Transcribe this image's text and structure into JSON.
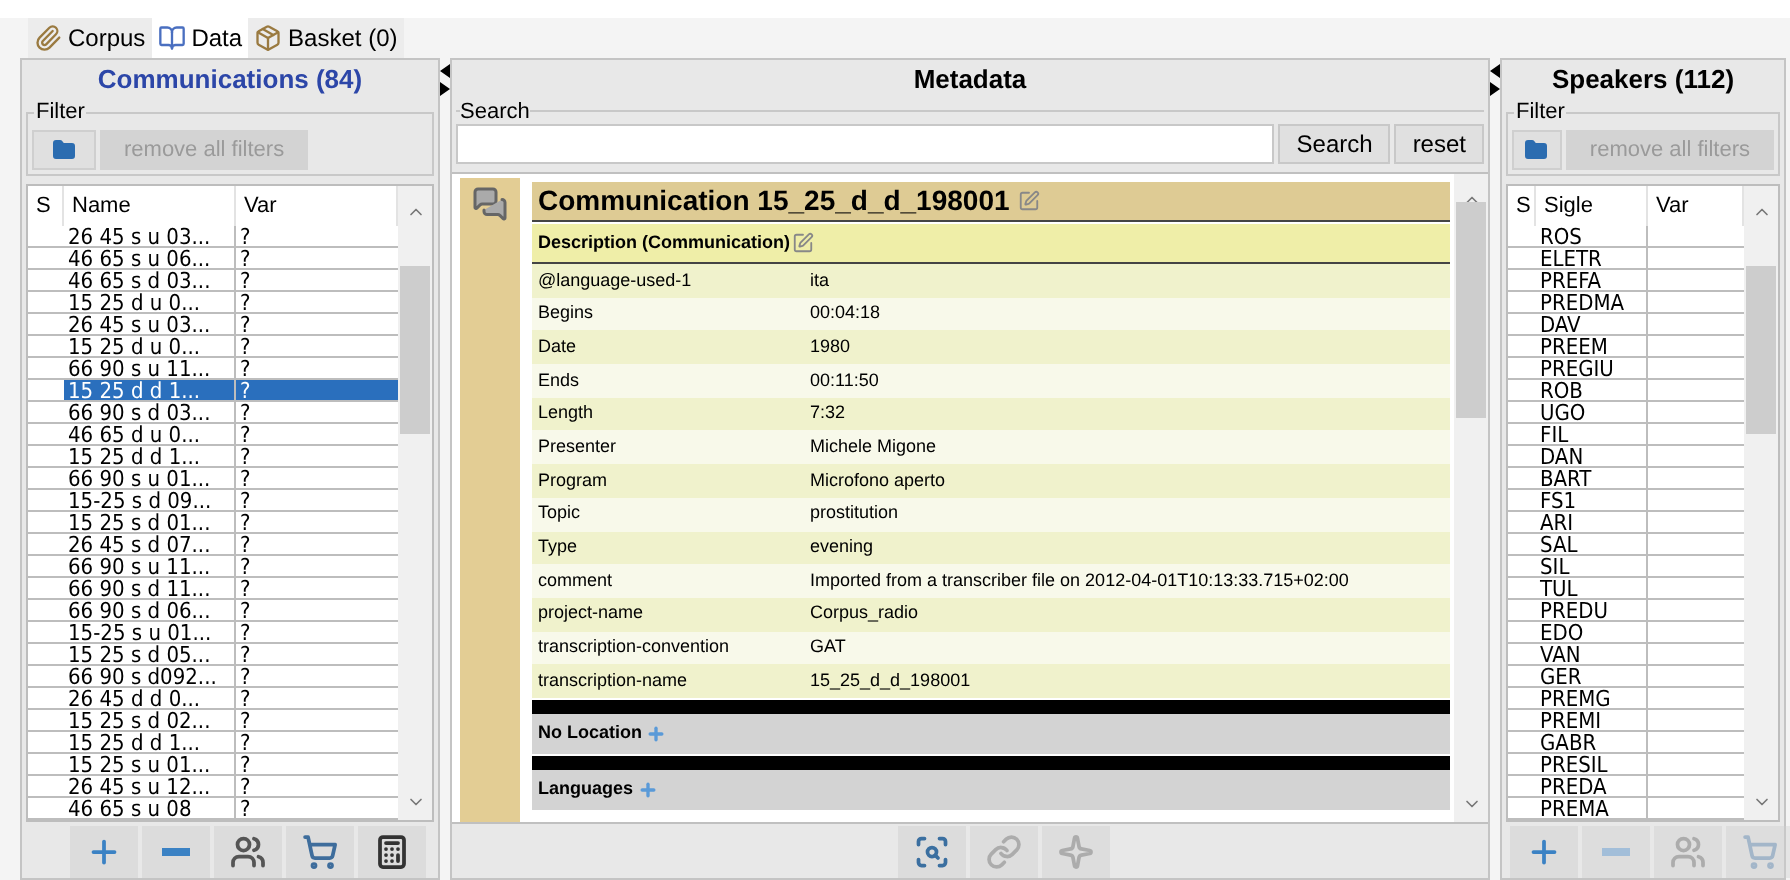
{
  "tabs": [
    {
      "label": "Corpus",
      "selected": false
    },
    {
      "label": "Data",
      "selected": true
    },
    {
      "label": "Basket (0)",
      "selected": false
    }
  ],
  "communications": {
    "title": "Communications (84)",
    "filter_label": "Filter",
    "remove_filters": {
      "label": "remove all filters",
      "disabled": true
    },
    "columns": [
      "S",
      "Name",
      "Var"
    ],
    "rows": [
      {
        "name": "26 45 s u 03...",
        "var": "?",
        "selected": false
      },
      {
        "name": "46 65 s u 06...",
        "var": "?",
        "selected": false
      },
      {
        "name": "46 65 s d 03...",
        "var": "?",
        "selected": false
      },
      {
        "name": "15 25 d u 0...",
        "var": "?",
        "selected": false
      },
      {
        "name": "26 45 s u 03...",
        "var": "?",
        "selected": false
      },
      {
        "name": "15 25 d u 0...",
        "var": "?",
        "selected": false
      },
      {
        "name": "66 90 s u 11...",
        "var": "?",
        "selected": false
      },
      {
        "name": "15 25 d d 1...",
        "var": "?",
        "selected": true
      },
      {
        "name": "66 90 s d 03...",
        "var": "?",
        "selected": false
      },
      {
        "name": "46 65 d u 0...",
        "var": "?",
        "selected": false
      },
      {
        "name": "15 25 d d 1...",
        "var": "?",
        "selected": false
      },
      {
        "name": "66 90 s u 01...",
        "var": "?",
        "selected": false
      },
      {
        "name": "15-25 s d 09...",
        "var": "?",
        "selected": false
      },
      {
        "name": "15 25 s d 01...",
        "var": "?",
        "selected": false
      },
      {
        "name": "26 45 s d 07...",
        "var": "?",
        "selected": false
      },
      {
        "name": "66 90 s u 11...",
        "var": "?",
        "selected": false
      },
      {
        "name": "66 90 s d 11...",
        "var": "?",
        "selected": false
      },
      {
        "name": "66 90 s d 06...",
        "var": "?",
        "selected": false
      },
      {
        "name": "15-25 s u 01...",
        "var": "?",
        "selected": false
      },
      {
        "name": "15 25 s d 05...",
        "var": "?",
        "selected": false
      },
      {
        "name": "66 90 s d092...",
        "var": "?",
        "selected": false
      },
      {
        "name": "26 45 d d 0...",
        "var": "?",
        "selected": false
      },
      {
        "name": "15 25 s d 02...",
        "var": "?",
        "selected": false
      },
      {
        "name": "15 25 d d 1...",
        "var": "?",
        "selected": false
      },
      {
        "name": "15 25 s u 01...",
        "var": "?",
        "selected": false
      },
      {
        "name": "26 45 s u 12...",
        "var": "?",
        "selected": false
      },
      {
        "name": "46 65 s u 08",
        "var": "?",
        "selected": false
      }
    ],
    "toolbar": [
      {
        "kind": "add",
        "disabled": false
      },
      {
        "kind": "remove",
        "disabled": false
      },
      {
        "kind": "people",
        "disabled": false
      },
      {
        "kind": "basket",
        "disabled": false
      },
      {
        "kind": "calculator",
        "disabled": false
      }
    ]
  },
  "metadata": {
    "title": "Metadata",
    "search_label": "Search",
    "search_button": "Search",
    "reset_button": "reset",
    "communication_title": "Communication 15_25_d_d_198001",
    "description_heading": "Description (Communication)",
    "fields": [
      {
        "key": "@language-used-1",
        "value": "ita"
      },
      {
        "key": "Begins",
        "value": "00:04:18"
      },
      {
        "key": "Date",
        "value": "1980"
      },
      {
        "key": "Ends",
        "value": "00:11:50"
      },
      {
        "key": "Length",
        "value": "7:32"
      },
      {
        "key": "Presenter",
        "value": "Michele Migone"
      },
      {
        "key": "Program",
        "value": "Microfono aperto"
      },
      {
        "key": "Topic",
        "value": "prostitution"
      },
      {
        "key": "Type",
        "value": "evening"
      },
      {
        "key": "comment",
        "value": "Imported from a transcriber file on 2012-04-01T10:13:33.715+02:00"
      },
      {
        "key": "project-name",
        "value": "Corpus_radio"
      },
      {
        "key": "transcription-convention",
        "value": "GAT"
      },
      {
        "key": "transcription-name",
        "value": "15_25_d_d_198001"
      }
    ],
    "sections": [
      {
        "label": "No Location"
      },
      {
        "label": "Languages"
      }
    ],
    "toolbar": [
      {
        "kind": "search-screen",
        "disabled": false
      },
      {
        "kind": "link",
        "disabled": true
      },
      {
        "kind": "star",
        "disabled": true
      }
    ]
  },
  "speakers": {
    "title": "Speakers (112)",
    "filter_label": "Filter",
    "remove_filters": {
      "label": "remove all filters",
      "disabled": true
    },
    "columns": [
      "S",
      "Sigle",
      "Var"
    ],
    "rows": [
      {
        "sigle": "ROS",
        "selected": false
      },
      {
        "sigle": "ELETR",
        "selected": false
      },
      {
        "sigle": "PREFA",
        "selected": false
      },
      {
        "sigle": "PREDMA",
        "selected": false
      },
      {
        "sigle": "DAV",
        "selected": false
      },
      {
        "sigle": "PREEM",
        "selected": false
      },
      {
        "sigle": "PREGIU",
        "selected": false
      },
      {
        "sigle": "ROB",
        "selected": false
      },
      {
        "sigle": "UGO",
        "selected": false
      },
      {
        "sigle": "FIL",
        "selected": false
      },
      {
        "sigle": "DAN",
        "selected": false
      },
      {
        "sigle": "BART",
        "selected": false
      },
      {
        "sigle": "FS1",
        "selected": false
      },
      {
        "sigle": "ARI",
        "selected": false
      },
      {
        "sigle": "SAL",
        "selected": false
      },
      {
        "sigle": "SIL",
        "selected": false
      },
      {
        "sigle": "TUL",
        "selected": false
      },
      {
        "sigle": "PREDU",
        "selected": false
      },
      {
        "sigle": "EDO",
        "selected": false
      },
      {
        "sigle": "VAN",
        "selected": false
      },
      {
        "sigle": "GER",
        "selected": false
      },
      {
        "sigle": "PREMG",
        "selected": false
      },
      {
        "sigle": "PREMI",
        "selected": false
      },
      {
        "sigle": "GABR",
        "selected": false
      },
      {
        "sigle": "PRESIL",
        "selected": false
      },
      {
        "sigle": "PREDA",
        "selected": false
      },
      {
        "sigle": "PREMA",
        "selected": false
      }
    ],
    "toolbar": [
      {
        "kind": "add",
        "disabled": false
      },
      {
        "kind": "remove",
        "disabled": true
      },
      {
        "kind": "people",
        "disabled": true
      },
      {
        "kind": "basket",
        "disabled": true
      }
    ]
  }
}
